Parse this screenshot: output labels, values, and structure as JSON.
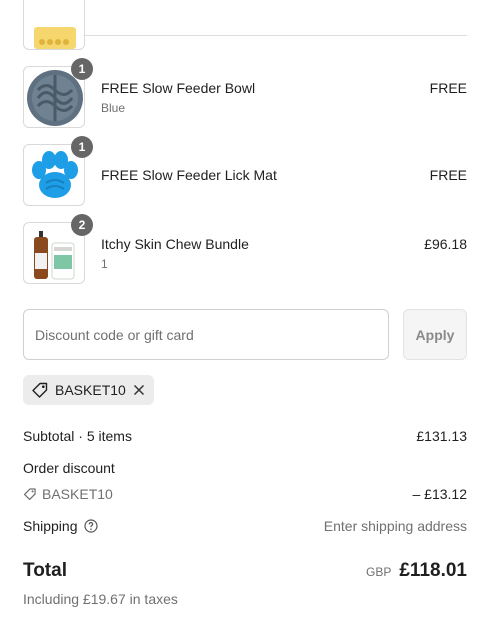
{
  "items": [
    {
      "name": "FREE Slow Feeder Bowl",
      "variant": "Blue",
      "price": "FREE",
      "quantity": "1",
      "image_icon": "slow-feeder-bowl-image"
    },
    {
      "name": "FREE Slow Feeder Lick Mat",
      "variant": "",
      "price": "FREE",
      "quantity": "1",
      "image_icon": "paw-lick-mat-image"
    },
    {
      "name": "Itchy Skin Chew Bundle",
      "variant": "1",
      "price": "£96.18",
      "quantity": "2",
      "image_icon": "chew-bundle-image"
    }
  ],
  "discount": {
    "placeholder": "Discount code or gift card",
    "apply_label": "Apply",
    "applied_code": "BASKET10"
  },
  "summary": {
    "subtotal_label": "Subtotal · 5 items",
    "subtotal_value": "£131.13",
    "order_discount_label": "Order discount",
    "discount_code": "BASKET10",
    "discount_value": "– £13.12",
    "shipping_label": "Shipping",
    "shipping_value": "Enter shipping address",
    "total_label": "Total",
    "total_currency": "GBP",
    "total_value": "£118.01",
    "tax_note": "Including £19.67 in taxes"
  },
  "colors": {
    "text": "#1f1f1f",
    "muted": "#707070",
    "badge": "#666666",
    "bowl_blue": "#5f7180",
    "lick_mat_blue": "#1e9ee6"
  }
}
